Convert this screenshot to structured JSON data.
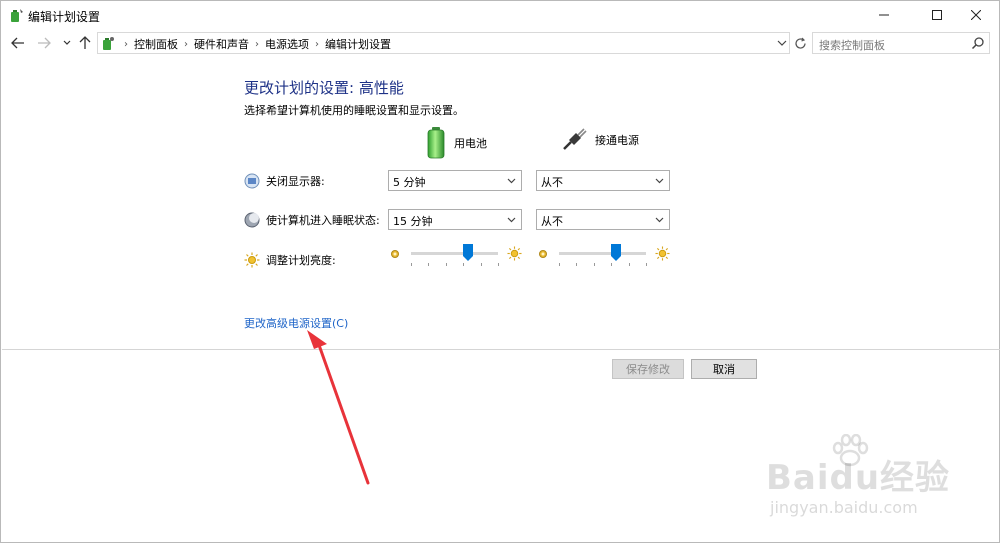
{
  "window": {
    "title": "编辑计划设置"
  },
  "nav": {
    "breadcrumbs": [
      "控制面板",
      "硬件和声音",
      "电源选项",
      "编辑计划设置"
    ],
    "search_placeholder": "搜索控制面板"
  },
  "content": {
    "heading": "更改计划的设置: 高性能",
    "subtitle": "选择希望计算机使用的睡眠设置和显示设置。",
    "columns": {
      "battery": "用电池",
      "plugged_in": "接通电源"
    },
    "rows": [
      {
        "label": "关闭显示器:",
        "battery": "5 分钟",
        "plugged_in": "从不"
      },
      {
        "label": "使计算机进入睡眠状态:",
        "battery": "15 分钟",
        "plugged_in": "从不"
      }
    ],
    "brightness": {
      "label": "调整计划亮度:",
      "battery_level": 0.65,
      "plugged_in_level": 0.65
    },
    "advanced_link": "更改高级电源设置(C)"
  },
  "buttons": {
    "save": "保存修改",
    "cancel": "取消"
  },
  "watermark": {
    "brand": "Baidu经验",
    "url": "jingyan.baidu.com"
  },
  "colors": {
    "heading": "#1e3287",
    "link": "#1e64c8",
    "annotation_arrow": "#e8333a"
  }
}
